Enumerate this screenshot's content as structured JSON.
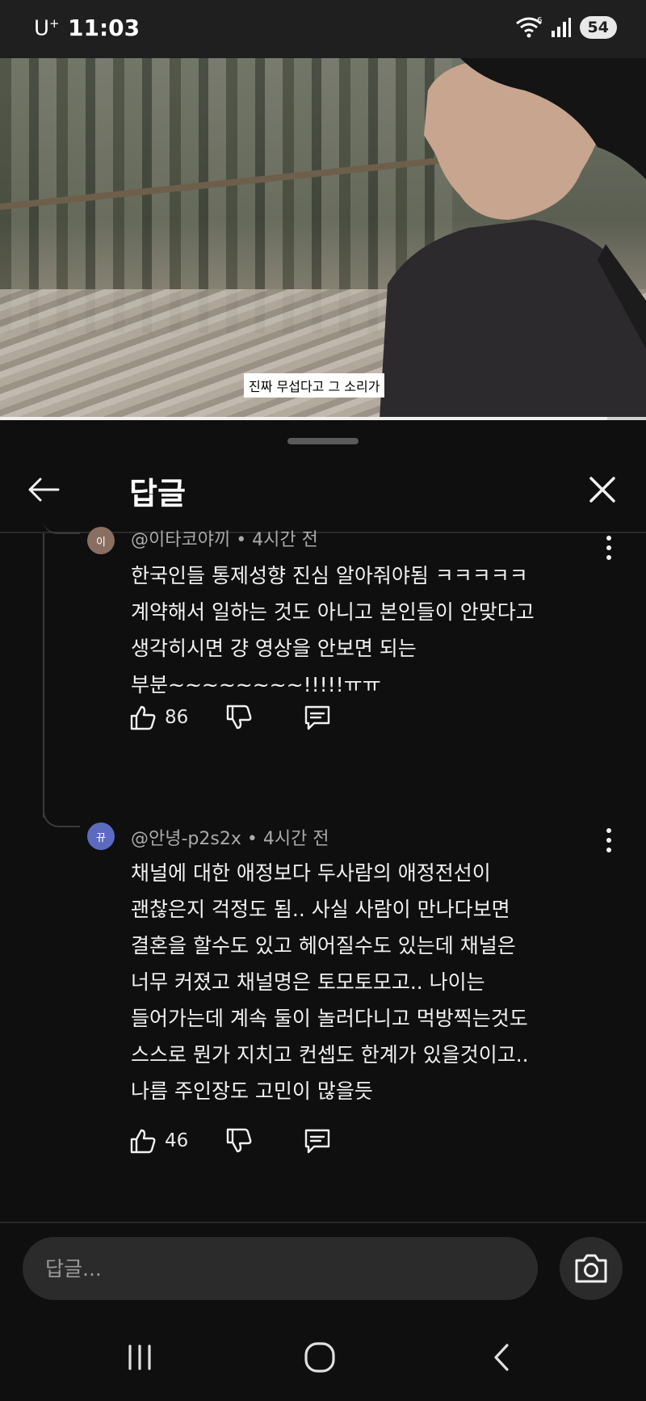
{
  "status_bar": {
    "carrier": "U",
    "carrier_sup": "+",
    "time": "11:03",
    "battery": "54",
    "wifi_label": "6"
  },
  "video": {
    "caption": "진짜 무섭다고 그 소리가",
    "progress": 0.94
  },
  "sheet": {
    "title": "답글"
  },
  "comments": [
    {
      "avatar_letter": "이",
      "avatar_color": "#8a6e62",
      "author": "@이타코야끼",
      "time": "4시간 전",
      "lines": [
        "한국인들 통제성향 진심 알아줘야됨 ㅋㅋㅋㅋㅋ",
        "계약해서 일하는 것도 아니고 본인들이 안맞다고",
        "생각히시면 걍 영상을 안보면 되는",
        "부분~~~~~~~~!!!!!ㅠㅠ"
      ],
      "likes": "86"
    },
    {
      "avatar_letter": "뀨",
      "avatar_color": "#5c6bc0",
      "author": "@안녕-p2s2x",
      "time": "4시간 전",
      "lines": [
        "채널에 대한 애정보다 두사람의 애정전선이",
        "괜찮은지 걱정도 됨.. 사실 사람이 만나다보면",
        "결혼을 할수도 있고 헤어질수도 있는데 채널은",
        "너무 커졌고 채널명은 토모토모고.. 나이는",
        "들어가는데 계속 둘이 놀러다니고 먹방찍는것도",
        "스스로 뭔가 지치고 컨셉도 한계가 있을것이고..",
        "나름 주인장도 고민이 많을듯"
      ],
      "likes": "46"
    }
  ],
  "reply_box": {
    "placeholder": "답글..."
  },
  "colors": {
    "background": "#0f0f0f",
    "text": "#f1f1f1",
    "meta": "#aaaaaa",
    "input_bg": "#2b2b2b"
  }
}
